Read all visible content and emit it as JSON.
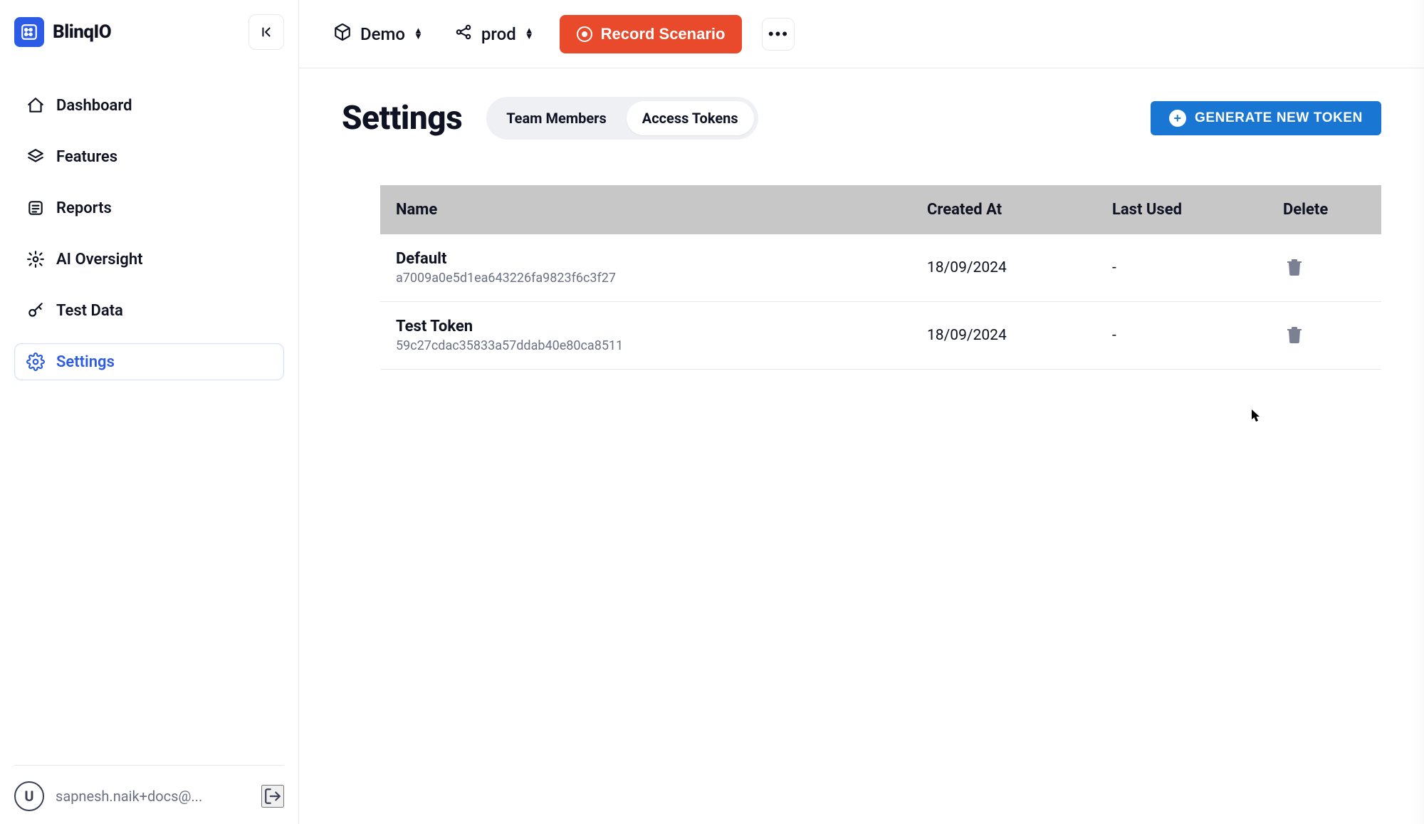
{
  "brand": {
    "name": "BlinqIO",
    "logo_icon": "blinq-logo"
  },
  "topbar": {
    "project": {
      "icon": "package-icon",
      "label": "Demo"
    },
    "env": {
      "icon": "share-nodes-icon",
      "label": "prod"
    },
    "record_label": "Record Scenario",
    "more_label": "..."
  },
  "sidebar": {
    "items": [
      {
        "icon": "home-icon",
        "label": "Dashboard",
        "active": false
      },
      {
        "icon": "layers-icon",
        "label": "Features",
        "active": false
      },
      {
        "icon": "list-icon",
        "label": "Reports",
        "active": false
      },
      {
        "icon": "shield-icon",
        "label": "AI Oversight",
        "active": false
      },
      {
        "icon": "key-icon",
        "label": "Test Data",
        "active": false
      },
      {
        "icon": "gear-icon",
        "label": "Settings",
        "active": true
      }
    ],
    "user": {
      "avatar_letter": "U",
      "email": "sapnesh.naik+docs@..."
    }
  },
  "page": {
    "title": "Settings",
    "tabs": [
      {
        "label": "Team Members",
        "active": false
      },
      {
        "label": "Access Tokens",
        "active": true
      }
    ],
    "primary_action": "GENERATE NEW TOKEN"
  },
  "table": {
    "columns": [
      "Name",
      "Created At",
      "Last Used",
      "Delete"
    ],
    "rows": [
      {
        "name": "Default",
        "hash": "a7009a0e5d1ea643226fa9823f6c3f27",
        "created": "18/09/2024",
        "last_used": "-"
      },
      {
        "name": "Test Token",
        "hash": "59c27cdac35833a57ddab40e80ca8511",
        "created": "18/09/2024",
        "last_used": "-"
      }
    ]
  },
  "colors": {
    "accent": "#2C5CE6",
    "primary_action": "#1976D2",
    "record": "#E94A2B"
  }
}
